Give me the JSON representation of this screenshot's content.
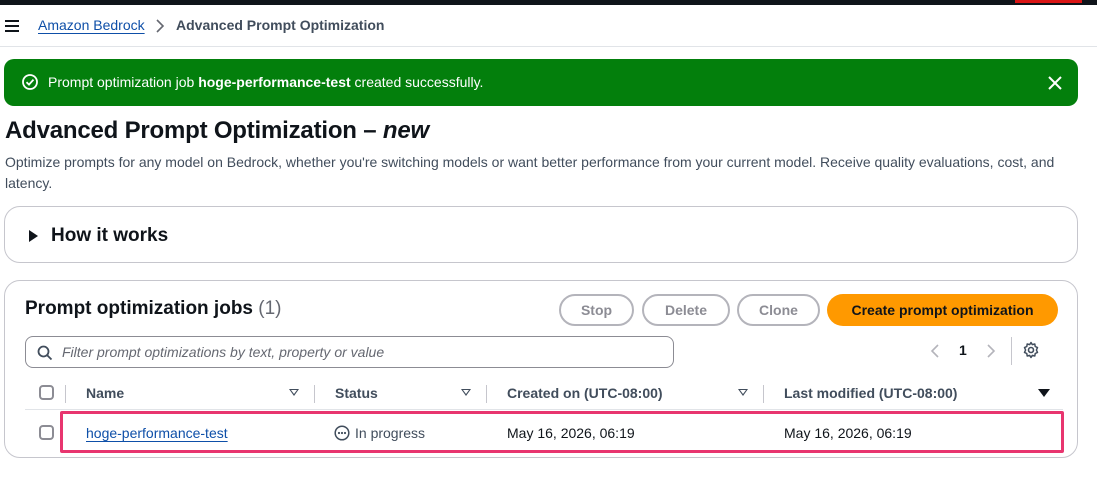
{
  "breadcrumb": {
    "parent": "Amazon Bedrock",
    "current": "Advanced Prompt Optimization"
  },
  "flash": {
    "prefix": "Prompt optimization job ",
    "job_name": "hoge-performance-test",
    "suffix": " created successfully.",
    "color": "#037f0c"
  },
  "header": {
    "title": "Advanced Prompt Optimization – ",
    "title_badge": "new",
    "description": "Optimize prompts for any model on Bedrock, whether you're switching models or want better performance from your current model. Receive quality evaluations, cost, and latency."
  },
  "how_it_works": {
    "label": "How it works"
  },
  "jobs": {
    "title": "Prompt optimization jobs",
    "count": "(1)",
    "buttons": {
      "stop": "Stop",
      "delete": "Delete",
      "clone": "Clone",
      "create": "Create prompt optimization"
    },
    "filter_placeholder": "Filter prompt optimizations by text, property or value",
    "pagination": {
      "current_page": "1"
    },
    "columns": {
      "name": "Name",
      "status": "Status",
      "created": "Created on (UTC-08:00)",
      "modified": "Last modified (UTC-08:00)"
    },
    "rows": [
      {
        "name": "hoge-performance-test",
        "status": "In progress",
        "created": "May 16, 2026, 06:19",
        "modified": "May 16, 2026, 06:19"
      }
    ]
  },
  "colors": {
    "link": "#0e4fa8",
    "primary_button": "#ff9900",
    "highlight": "#e8356f"
  }
}
